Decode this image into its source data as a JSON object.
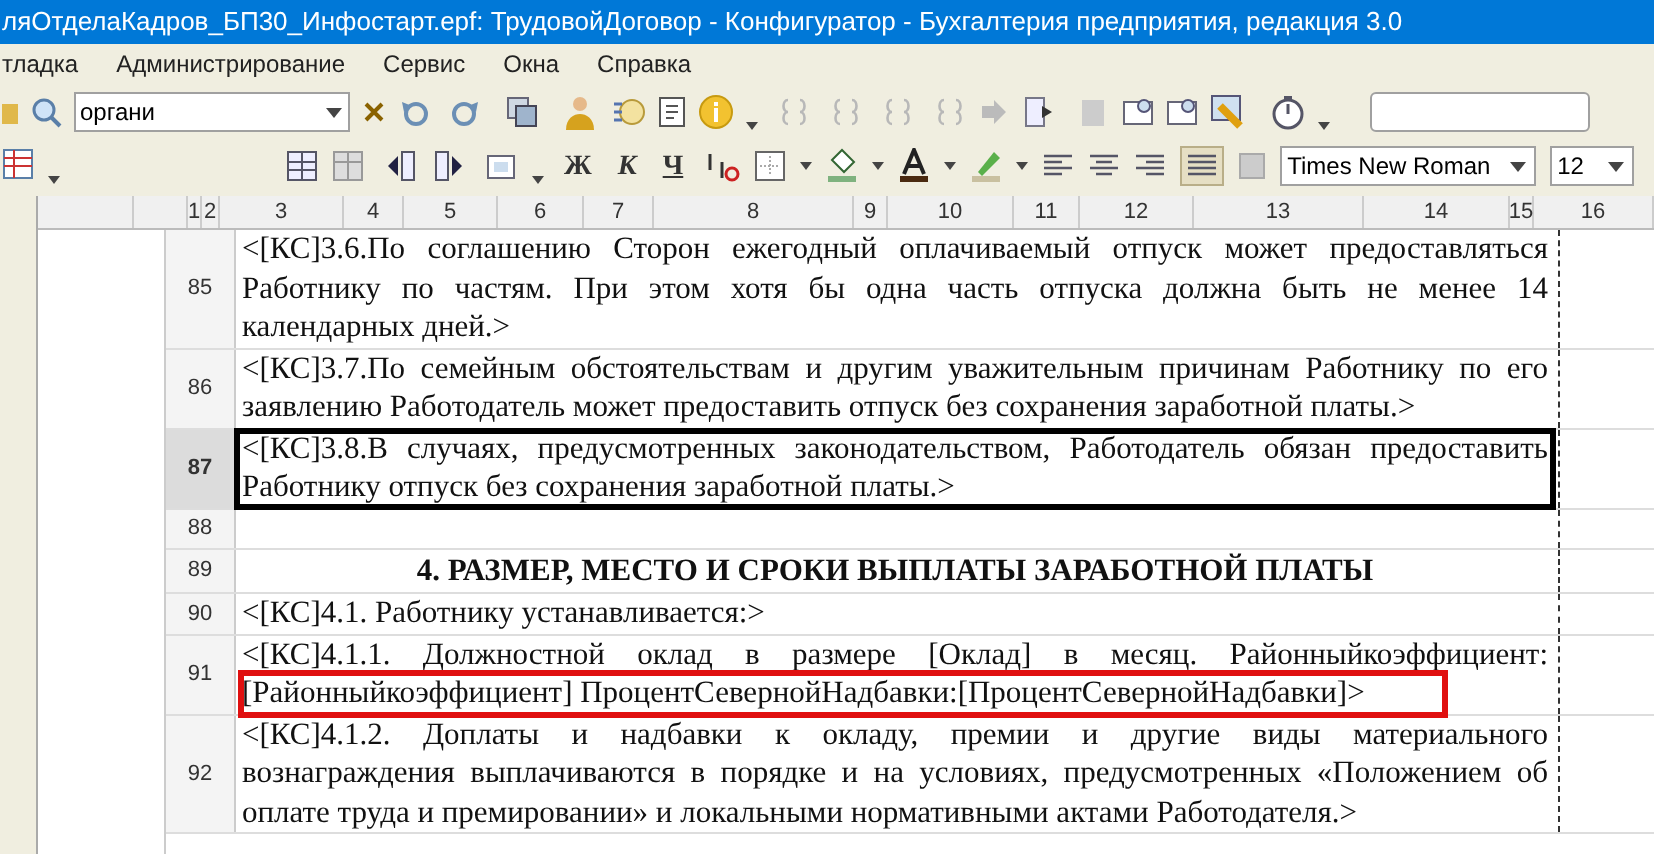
{
  "window": {
    "title": "ляОтделаКадров_БП30_Инфостарт.epf: ТрудовойДоговор - Конфигуратор - Бухгалтерия предприятия, редакция 3.0"
  },
  "menu": [
    "тладка",
    "Администрирование",
    "Сервис",
    "Окна",
    "Справка"
  ],
  "search": {
    "value": "органи"
  },
  "format_buttons": [
    "Ж",
    "К",
    "Ч"
  ],
  "font": {
    "family": "Times New Roman",
    "size": "12"
  },
  "ruler": [
    "1",
    "2",
    "3",
    "4",
    "5",
    "6",
    "7",
    "8",
    "9",
    "10",
    "11",
    "12",
    "13",
    "14",
    "15",
    "16"
  ],
  "rows": [
    {
      "number": "85",
      "kind": "text",
      "selected": false,
      "lines": [
        {
          "text": "<[КС]3.6.По соглашению Сторон ежегодный оплачиваемый отпуск может предоставляться",
          "framed": false
        },
        {
          "text": "Работнику по частям. При этом хотя бы одна часть отпуска должна быть не менее 14",
          "framed": false
        },
        {
          "text": "календарных дней.>",
          "framed": false
        }
      ]
    },
    {
      "number": "86",
      "kind": "text",
      "selected": false,
      "lines": [
        {
          "text": "<[КС]3.7.По семейным обстоятельствам и другим уважительным причинам Работнику по его",
          "framed": false
        },
        {
          "text": "заявлению Работодатель может предоставить отпуск без сохранения заработной платы.>",
          "framed": false
        }
      ]
    },
    {
      "number": "87",
      "kind": "text",
      "selected": true,
      "lines": [
        {
          "text": "<[КС]3.8.В случаях, предусмотренных законодательством, Работодатель обязан предоставить",
          "framed": false
        },
        {
          "text": "Работнику отпуск без сохранения заработной платы.>",
          "framed": false
        }
      ]
    },
    {
      "number": "88",
      "kind": "empty",
      "selected": false
    },
    {
      "number": "89",
      "kind": "heading",
      "selected": false,
      "lines": [
        {
          "text": "4. РАЗМЕР, МЕСТО И СРОКИ ВЫПЛАТЫ ЗАРАБОТНОЙ ПЛАТЫ",
          "framed": false
        }
      ]
    },
    {
      "number": "90",
      "kind": "text",
      "selected": false,
      "lines": [
        {
          "text": "<[КС]4.1. Работнику устанавливается:>",
          "framed": false
        }
      ]
    },
    {
      "number": "91",
      "kind": "text",
      "selected": false,
      "lines": [
        {
          "text": "<[КС]4.1.1. Должностной оклад в размере [Оклад] в месяц. Районныйкоэффициент:",
          "framed": false
        },
        {
          "text": "[Районныйкоэффициент] ПроцентСевернойНадбавки:[ПроцентСевернойНадбавки]>",
          "framed": true
        }
      ]
    },
    {
      "number": "92",
      "kind": "text",
      "selected": false,
      "lines": [
        {
          "text": "<[КС]4.1.2. Доплаты и надбавки к окладу, премии и другие виды материального",
          "framed": false
        },
        {
          "text": "вознаграждения выплачиваются в порядке и на условиях, предусмотренных «Положением об",
          "framed": false
        },
        {
          "text": "оплате труда и премировании» и локальными нормативными актами Работодателя.>",
          "framed": false
        }
      ]
    }
  ]
}
